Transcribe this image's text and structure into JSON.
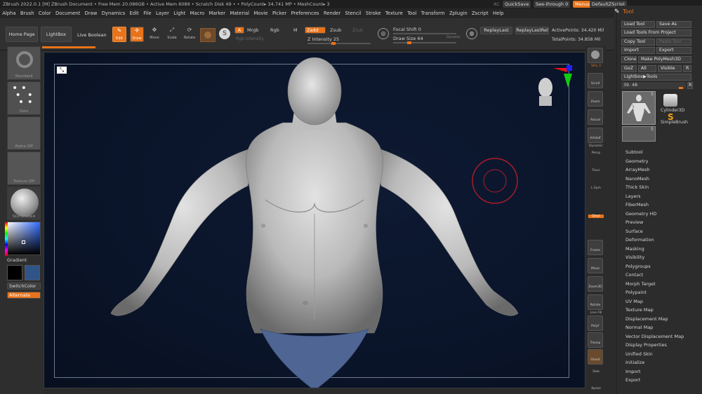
{
  "titlebar": {
    "app": "ZBrush 2022.0.1 [M]   ZBrush Document     • Free Mem 20.086GB • Active Mem 6089 • Scratch Disk 49 • • PolyCount▸ 34.741 MP  • MeshCount▸ 3",
    "ac": "AC",
    "quicksave": "QuickSave",
    "see_through": "See-through  0",
    "menus": "Menus",
    "default_zscript": "DefaultZScript"
  },
  "menu": [
    "Alpha",
    "Brush",
    "Color",
    "Document",
    "Draw",
    "Dynamics",
    "Edit",
    "File",
    "Layer",
    "Light",
    "Macro",
    "Marker",
    "Material",
    "Movie",
    "Picker",
    "Preferences",
    "Render",
    "Stencil",
    "Stroke",
    "Texture",
    "Tool",
    "Transform",
    "Zplugin",
    "Zscript",
    "Help"
  ],
  "shelf": {
    "home_page": "Home Page",
    "lightbox": "LightBox",
    "live_boolean": "Live Boolean",
    "edit": "Edit",
    "draw": "Draw",
    "move": "Move",
    "scale": "Scale",
    "rotate": "Rotate",
    "a": "A",
    "mrgb": "Mrgb",
    "rgb": "Rgb",
    "m": "M",
    "zadd": "Zadd",
    "zsub": "Zsub",
    "zcut": "Zcut",
    "rgb_intensity": "Rgb Intensity",
    "z_intensity": "Z Intensity 25",
    "focal_shift": "Focal Shift 0",
    "draw_size": "Draw Size 64",
    "dynamic": "Dynamic",
    "replay_last": "ReplayLast",
    "replay_last_rel": "ReplayLastRel",
    "active_points": "ActivePoints: 34.420 Mil",
    "total_points": "TotalPoints: 34.858 Mil"
  },
  "left": {
    "brush": "Standard",
    "stroke": "Dots",
    "alpha": "Alpha Off",
    "texture": "Texture Off",
    "material": "SkinShade4",
    "gradient": "Gradient",
    "switch_color": "SwitchColor",
    "alternate": "Alternate"
  },
  "rightstrip": [
    "SPix 3",
    "Scroll",
    "Zoom",
    "Actual",
    "AAHalf",
    "Dynamic",
    "Persp",
    "Floor",
    "L.Sym",
    "Qxyz",
    "Frame",
    "Move",
    "Zoom3D",
    "Rotate",
    "Line Fill",
    "PolyF",
    "Transp",
    "Ghost",
    "Solo",
    "Xpose"
  ],
  "tool": {
    "title": "Tool",
    "load_tool": "Load Tool",
    "save_as": "Save As",
    "load_from_project": "Load Tools From Project",
    "copy_tool": "Copy Tool",
    "paste_tool": "Paste Tool",
    "import": "Import",
    "export": "Export",
    "clone": "Clone",
    "make_polymesh": "Make PolyMesh3D",
    "goz": "GoZ",
    "all": "All",
    "visible": "Visible",
    "r": "R",
    "lightbox_tools": "Lightbox▶Tools",
    "value": "39. 48",
    "cylinder": "Cylinder3D",
    "simple_brush": "SimpleBrush",
    "count_a": "5",
    "count_b": "5",
    "subpalettes": [
      "Subtool",
      "Geometry",
      "ArrayMesh",
      "NanoMesh",
      "Thick Skin",
      "Layers",
      "FiberMesh",
      "Geometry HD",
      "Preview",
      "Surface",
      "Deformation",
      "Masking",
      "Visibility",
      "Polygroups",
      "Contact",
      "Morph Target",
      "Polypaint",
      "UV Map",
      "Texture Map",
      "Displacement Map",
      "Normal Map",
      "Vector Displacement Map",
      "Display Properties",
      "Unified Skin",
      "Initialize",
      "Import",
      "Export"
    ]
  },
  "colors": {
    "accent": "#e8731a",
    "viewport": "#0a1429",
    "secondary_color": "#2f5487"
  }
}
